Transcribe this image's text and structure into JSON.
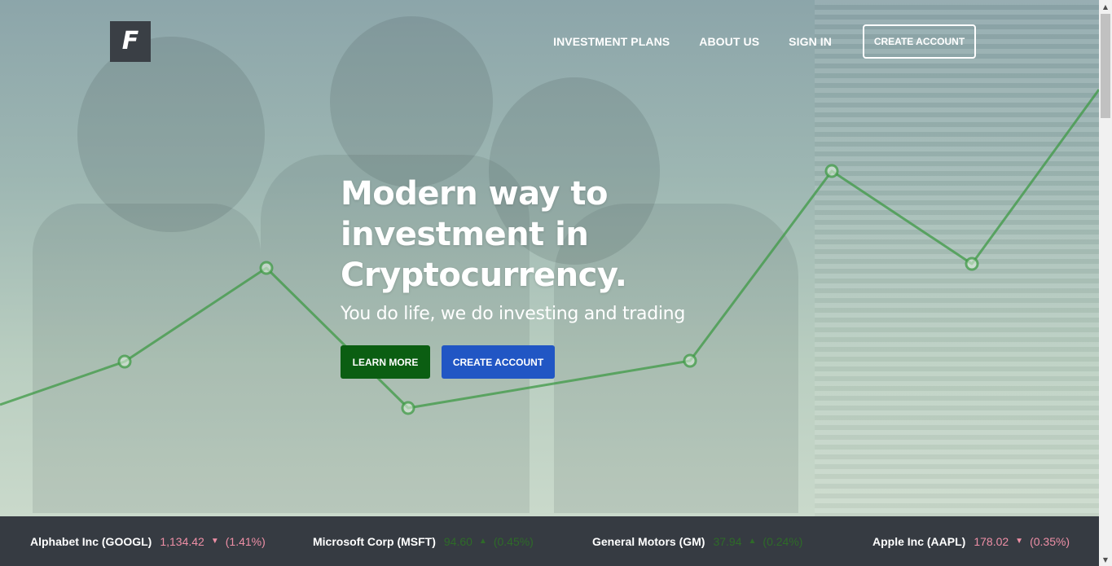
{
  "brand": {
    "logo_letter": "F"
  },
  "nav": {
    "items": [
      {
        "label": "INVESTMENT PLANS"
      },
      {
        "label": "ABOUT US"
      },
      {
        "label": "SIGN IN"
      }
    ],
    "cta_label": "CREATE ACCOUNT"
  },
  "hero": {
    "headline_line1": "Modern way to",
    "headline_line2": "investment in",
    "headline_line3": "Cryptocurrency.",
    "subheadline": "You do life, we do investing and trading",
    "learn_more_label": "LEARN MORE",
    "create_account_label": "CREATE ACCOUNT"
  },
  "ticker": [
    {
      "name": "Alphabet Inc (GOOGL)",
      "price": "1,134.42",
      "change": "(1.41%)",
      "direction": "down"
    },
    {
      "name": "Microsoft Corp (MSFT)",
      "price": "94.60",
      "change": "(0.45%)",
      "direction": "up"
    },
    {
      "name": "General Motors (GM)",
      "price": "37.94",
      "change": "(0.24%)",
      "direction": "up"
    },
    {
      "name": "Apple Inc (AAPL)",
      "price": "178.02",
      "change": "(0.35%)",
      "direction": "down"
    }
  ],
  "colors": {
    "learn_more_bg": "#0b5e12",
    "create_account_bg": "#2156c4",
    "ticker_bg": "#363b42",
    "ticker_down": "#ee8fa6",
    "ticker_up": "#2e6b28",
    "chart_line": "#3f9a46"
  },
  "icons": {
    "arrow_down": "caret-down-icon",
    "arrow_up": "caret-up-icon"
  }
}
